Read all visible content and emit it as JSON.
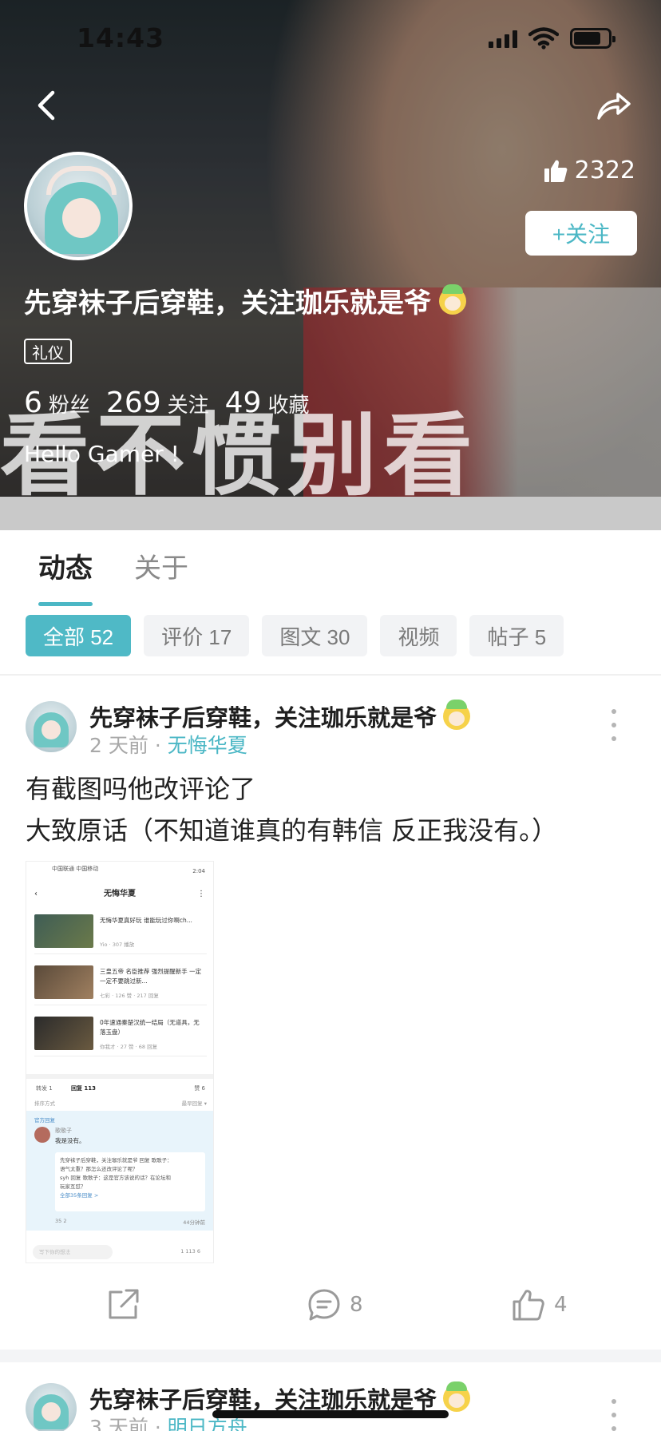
{
  "status_bar": {
    "time": "14:43"
  },
  "profile": {
    "like_count": "2322",
    "follow_label": "+关注",
    "name": "先穿袜子后穿鞋，关注珈乐就是爷",
    "tag": "礼仪",
    "stats": [
      {
        "value": "6",
        "label": "粉丝"
      },
      {
        "value": "269",
        "label": "关注"
      },
      {
        "value": "49",
        "label": "收藏"
      }
    ],
    "bio": "Hello Gamer !",
    "banner_caption": "看不惯别看"
  },
  "tabs": [
    {
      "label": "动态",
      "active": true
    },
    {
      "label": "关于",
      "active": false
    }
  ],
  "filters": [
    {
      "label": "全部 52",
      "active": true
    },
    {
      "label": "评价 17",
      "active": false
    },
    {
      "label": "图文 30",
      "active": false
    },
    {
      "label": "视频",
      "active": false
    },
    {
      "label": "帖子 5",
      "active": false
    }
  ],
  "post": {
    "author": "先穿袜子后穿鞋，关注珈乐就是爷",
    "time": "2 天前",
    "separator": "·",
    "game": "无悔华夏",
    "body_line1": "有截图吗他改评论了",
    "body_line2": "大致原话（不知道谁真的有韩信 反正我没有。）",
    "actions": {
      "comment_count": "8",
      "like_count": "4"
    },
    "screenshot": {
      "carrier": "中国联通 中国移动",
      "time": "2:04",
      "title": "无悔华夏",
      "back": "‹",
      "menu": "⋮",
      "rows": [
        {
          "title": "无悔华夏真好玩 谁能玩过你啊ch...",
          "sub": "Yio · 307 播放",
          "badge": "00:29"
        },
        {
          "title": "三皇五帝 名臣推荐 强烈提醒新手 一定一定不要跳过新...",
          "sub": "七彩 · 126 赞 · 217 回复"
        },
        {
          "title": "0年速通秦楚汉统一结局（无道具，无落玉盘）",
          "sub": "你我才 · 27 赞 · 68 回复"
        }
      ],
      "tab_forward": "转发 1",
      "tab_reply": "回复 113",
      "tab_like": "赞 6",
      "sort": "排序方式",
      "sort_value": "最早回复 ▾",
      "official": "官方回复",
      "reply_name": "歌歌子",
      "reply_text": "我是没有。",
      "quote_line1": "先穿袜子后穿鞋，关注珈乐就是爷 回复 歌歌子：",
      "quote_line2": "语气太重？那怎么还改评论了呢？",
      "quote_line3": "syh 回复 歌歌子：这是官方该说的话？在论坛和",
      "quote_line4": "玩家互怼？",
      "quote_more": "全部35条回复 >",
      "reply_actions": "35  2",
      "reply_time": "44分钟前",
      "input_placeholder": "写下你的想法",
      "bottom_actions": "1   113   6"
    }
  },
  "post2": {
    "author": "先穿袜子后穿鞋，关注珈乐就是爷",
    "time": "3 天前",
    "separator": "·",
    "game": "明日方舟"
  },
  "colors": {
    "accent": "#4bb7c5",
    "chip_active": "#4fb9c6"
  }
}
